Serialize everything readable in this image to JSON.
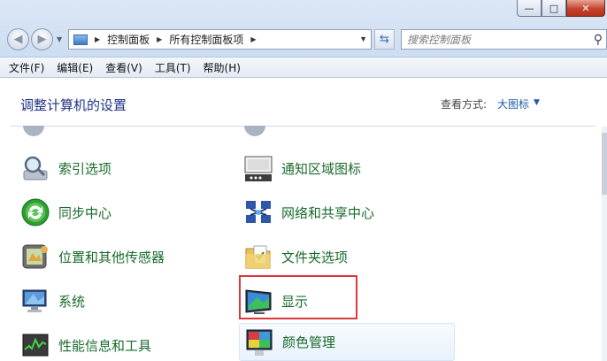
{
  "window": {
    "minimize": "—",
    "maximize": "□",
    "close": "✕"
  },
  "navigation": {
    "back": "◀",
    "forward": "▶",
    "breadcrumb": [
      "控制面板",
      "所有控制面板项"
    ],
    "search_placeholder": "搜索控制面板"
  },
  "menu": [
    "文件(F)",
    "编辑(E)",
    "查看(V)",
    "工具(T)",
    "帮助(H)"
  ],
  "header": {
    "title": "调整计算机的设置",
    "view_by_label": "查看方式:",
    "view_by_value": "大图标"
  },
  "items": {
    "indexing": "索引选项",
    "sync": "同步中心",
    "location": "位置和其他传感器",
    "system": "系统",
    "performance": "性能信息和工具",
    "notification": "通知区域图标",
    "network": "网络和共享中心",
    "folder": "文件夹选项",
    "display": "显示",
    "color": "颜色管理"
  },
  "colors": {
    "label_green": "#1a6a2c",
    "title_blue": "#1e3287",
    "highlight_red": "#d9383c"
  }
}
